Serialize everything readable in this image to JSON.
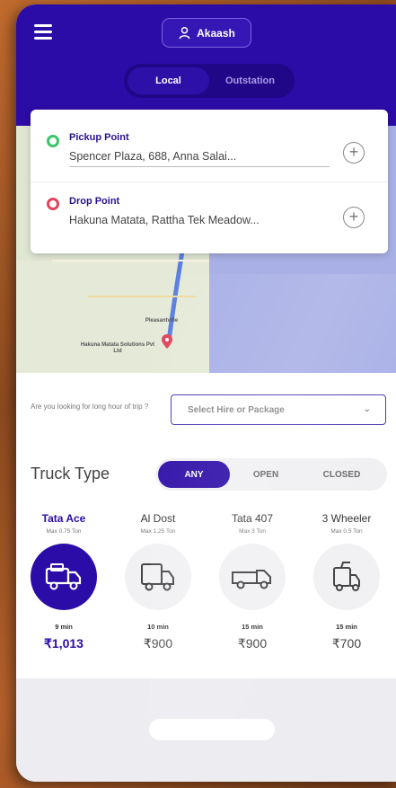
{
  "header": {
    "user_name": "Akaash",
    "tabs": [
      {
        "label": "Local",
        "active": true
      },
      {
        "label": "Outstation",
        "active": false
      }
    ]
  },
  "map": {
    "place_label_1": "Pleasantville",
    "place_label_2": "Hakuna Matata Solutions Pvt Ltd"
  },
  "locations": {
    "pickup": {
      "title": "Pickup Point",
      "address": "Spencer Plaza, 688, Anna Salai..."
    },
    "drop": {
      "title": "Drop Point",
      "address": "Hakuna Matata, Rattha Tek Meadow..."
    }
  },
  "trip": {
    "question": "Are you looking for long hour of trip ?",
    "select_placeholder": "Select Hire or Package"
  },
  "truck_type": {
    "label": "Truck Type",
    "options": [
      {
        "label": "ANY",
        "active": true
      },
      {
        "label": "OPEN",
        "active": false
      },
      {
        "label": "CLOSED",
        "active": false
      }
    ]
  },
  "vehicles": [
    {
      "name": "Tata Ace",
      "capacity": "Max 0.75 Ton",
      "time": "9 min",
      "price": "₹1,013",
      "active": true
    },
    {
      "name": "Al Dost",
      "capacity": "Max 1.25 Ton",
      "time": "10 min",
      "price": "₹900",
      "active": false
    },
    {
      "name": "Tata 407",
      "capacity": "Max 3 Ton",
      "time": "15 min",
      "price": "₹900",
      "active": false
    },
    {
      "name": "3 Wheeler",
      "capacity": "Max 0.5 Ton",
      "time": "15 min",
      "price": "₹700",
      "active": false
    }
  ],
  "colors": {
    "primary": "#2c0ca6",
    "pickup_dot": "#3cc46a",
    "drop_dot": "#e0455a"
  }
}
